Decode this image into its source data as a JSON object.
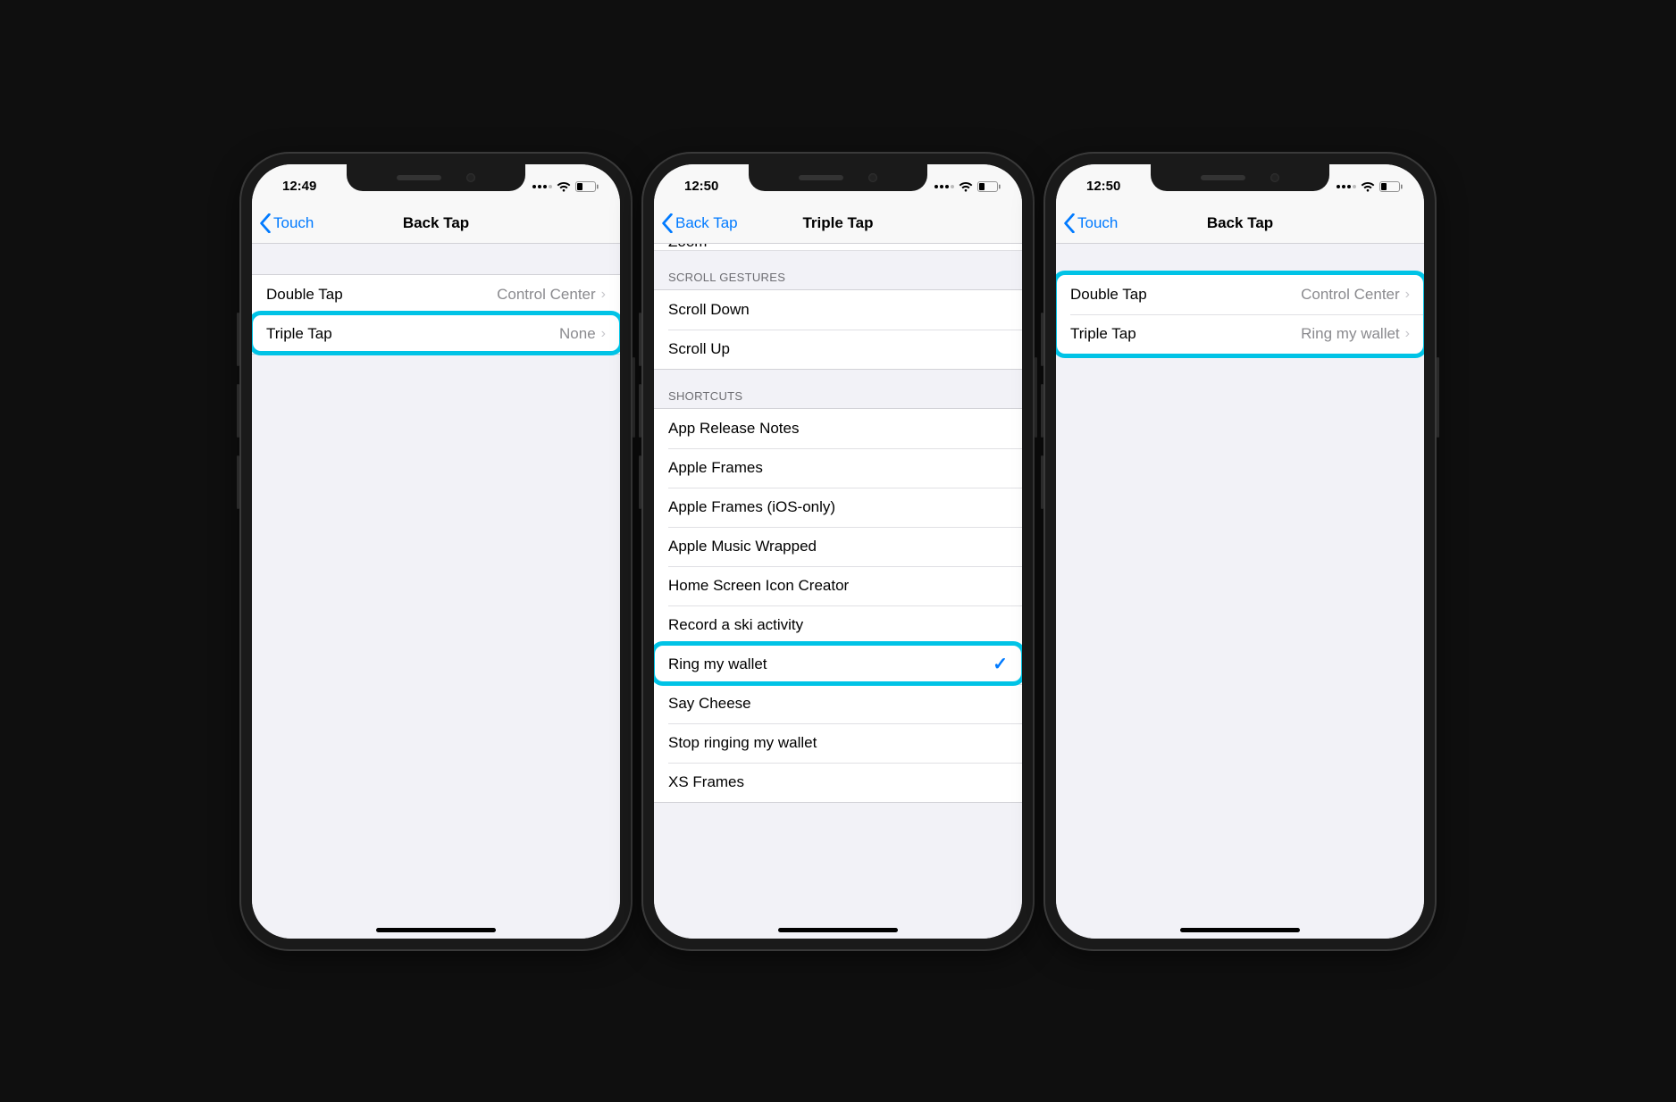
{
  "highlight_color": "#00c3e6",
  "ios_accent": "#007aff",
  "phones": [
    {
      "status": {
        "time": "12:49"
      },
      "nav": {
        "back": "Touch",
        "title": "Back Tap"
      },
      "rows": [
        {
          "label": "Double Tap",
          "value": "Control Center"
        },
        {
          "label": "Triple Tap",
          "value": "None"
        }
      ],
      "highlight_row": 1
    },
    {
      "status": {
        "time": "12:50"
      },
      "nav": {
        "back": "Back Tap",
        "title": "Triple Tap"
      },
      "partial_row_top": "Zoom",
      "sections": [
        {
          "header": "SCROLL GESTURES",
          "items": [
            {
              "label": "Scroll Down"
            },
            {
              "label": "Scroll Up"
            }
          ]
        },
        {
          "header": "SHORTCUTS",
          "items": [
            {
              "label": "App Release Notes"
            },
            {
              "label": "Apple Frames"
            },
            {
              "label": "Apple Frames (iOS-only)"
            },
            {
              "label": "Apple Music Wrapped"
            },
            {
              "label": "Home Screen Icon Creator"
            },
            {
              "label": "Record a ski activity"
            },
            {
              "label": "Ring my wallet",
              "checked": true
            },
            {
              "label": "Say Cheese"
            },
            {
              "label": "Stop ringing my wallet"
            },
            {
              "label": "XS Frames"
            }
          ]
        }
      ],
      "highlight_item": "Ring my wallet"
    },
    {
      "status": {
        "time": "12:50"
      },
      "nav": {
        "back": "Touch",
        "title": "Back Tap"
      },
      "rows": [
        {
          "label": "Double Tap",
          "value": "Control Center"
        },
        {
          "label": "Triple Tap",
          "value": "Ring my wallet"
        }
      ],
      "highlight_group": true
    }
  ]
}
